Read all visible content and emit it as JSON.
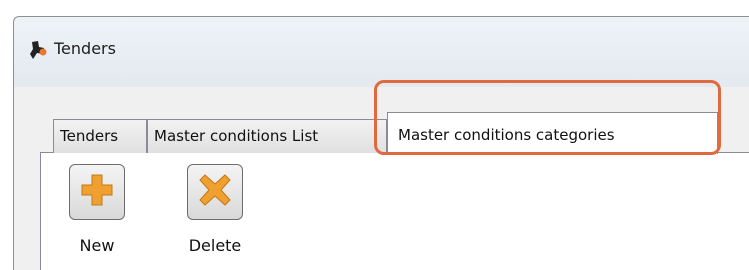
{
  "window": {
    "title": "Tenders",
    "icon": "tenders-app-icon"
  },
  "tabs": [
    {
      "label": "Tenders",
      "active": false
    },
    {
      "label": "Master conditions List",
      "active": false
    },
    {
      "label": "Master conditions categories",
      "active": true
    }
  ],
  "toolbar": {
    "new_label": "New",
    "new_icon": "plus-icon",
    "delete_label": "Delete",
    "delete_icon": "x-icon"
  },
  "colors": {
    "highlight": "#e06a3d",
    "icon_orange": "#f0a030"
  }
}
